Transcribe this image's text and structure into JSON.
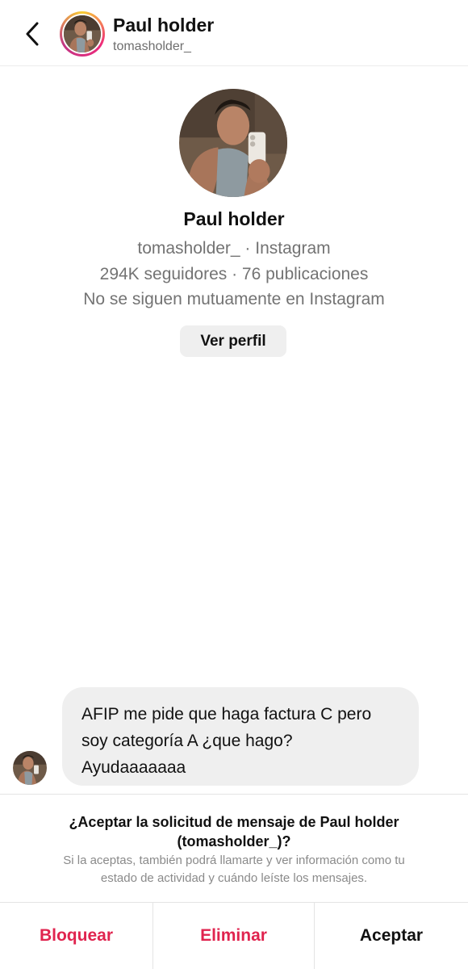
{
  "header": {
    "name": "Paul holder",
    "username": "tomasholder_"
  },
  "profile": {
    "name": "Paul holder",
    "meta": "tomasholder_ · Instagram",
    "stats": "294K seguidores · 76 publicaciones",
    "mutual": "No se siguen mutuamente en Instagram",
    "view_profile_label": "Ver perfil"
  },
  "message": {
    "line1": "AFIP me pide que haga factura C pero",
    "line2": "soy categoría A ¿que hago?",
    "line3": "Ayudaaaaaaa"
  },
  "request": {
    "title_line1": "¿Aceptar la solicitud de mensaje de Paul holder",
    "title_line2": "(tomasholder_)?",
    "desc_line1": "Si la aceptas, también podrá llamarte y ver información como tu",
    "desc_line2": "estado de actividad y cuándo leíste los mensajes."
  },
  "actions": {
    "block": "Bloquear",
    "delete": "Eliminar",
    "accept": "Aceptar"
  },
  "colors": {
    "destructive": "#e0244f",
    "secondary_text": "#737373",
    "bubble_bg": "#efefef"
  },
  "icons": {
    "back": "chevron-left-icon"
  }
}
